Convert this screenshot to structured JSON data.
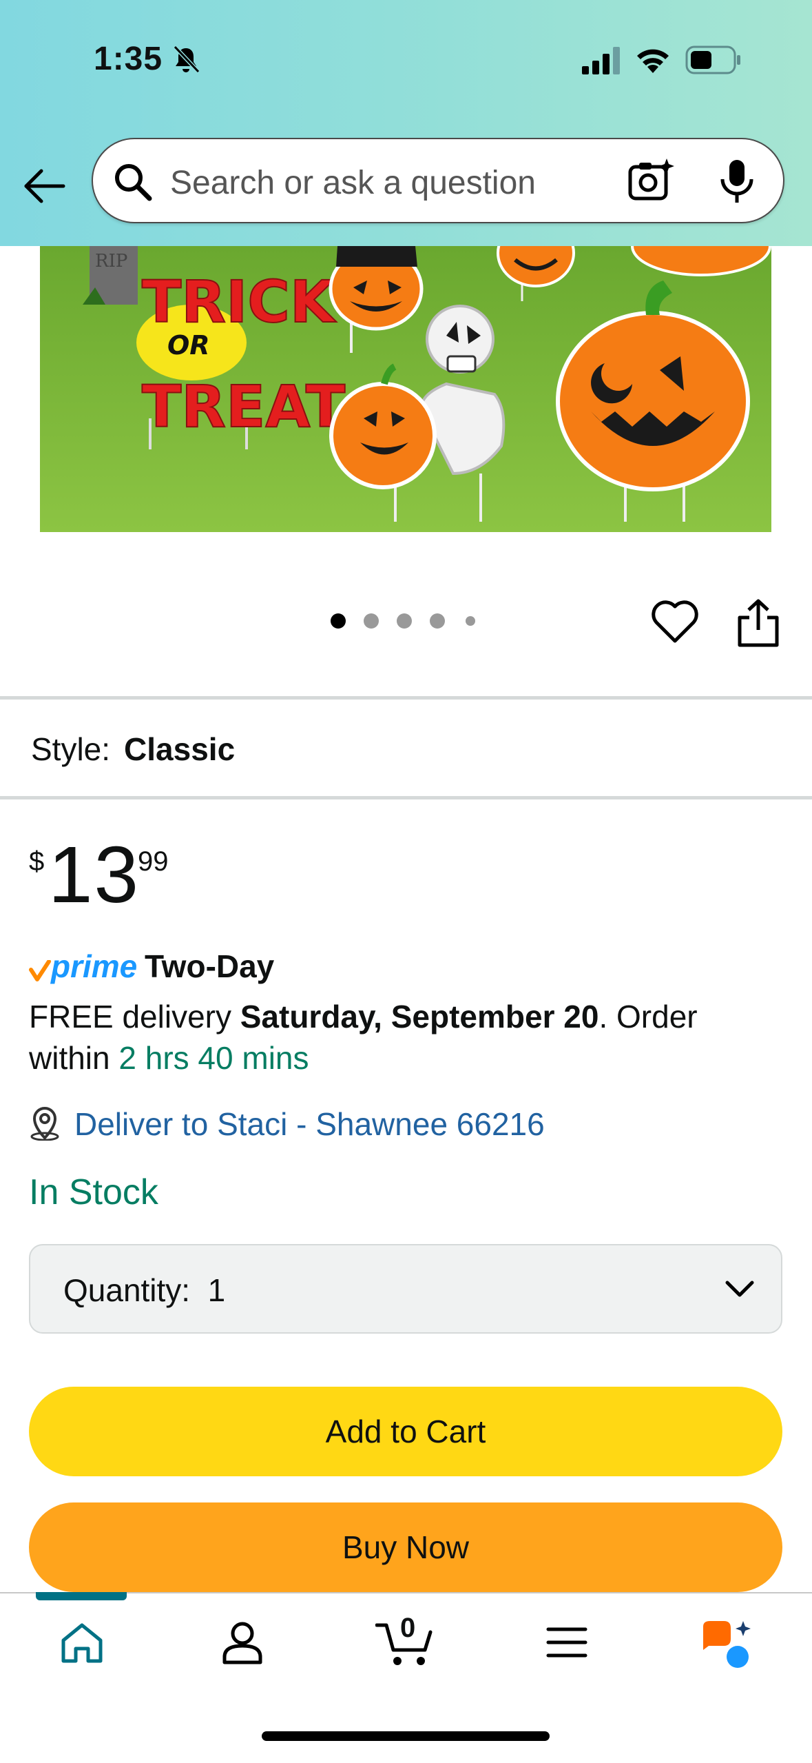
{
  "status_bar": {
    "time": "1:35"
  },
  "search": {
    "placeholder": "Search or ask a question"
  },
  "style_row": {
    "label": "Style:",
    "value": "Classic"
  },
  "price": {
    "symbol": "$",
    "whole": "13",
    "fraction": "99"
  },
  "prime": {
    "brand": "prime",
    "speed": "Two-Day"
  },
  "delivery": {
    "prefix": "FREE delivery ",
    "date": "Saturday, September 20",
    "middle": ". Order within ",
    "countdown": "2 hrs 40 mins"
  },
  "location": {
    "text": "Deliver to Staci - Shawnee 66216"
  },
  "stock": {
    "status": "In Stock"
  },
  "quantity": {
    "label": "Quantity:",
    "value": "1"
  },
  "buttons": {
    "add_to_cart": "Add to Cart",
    "buy_now": "Buy Now"
  },
  "carousel": {
    "total_images": 5,
    "active_index": 0
  },
  "hero_image": {
    "sign_text_top": "TRICK",
    "sign_text_mid": "OR",
    "sign_text_bottom": "TREAT",
    "tombstone_text": "RIP"
  },
  "tab_bar": {
    "cart_count": "0",
    "active_tab": "home"
  },
  "colors": {
    "header_gradient_start": "#82d8e0",
    "add_to_cart": "#ffd814",
    "buy_now": "#ffa41c",
    "link": "#2162a1",
    "in_stock": "#067d62",
    "prime_blue": "#1a98ff",
    "active_tab": "#007185"
  }
}
